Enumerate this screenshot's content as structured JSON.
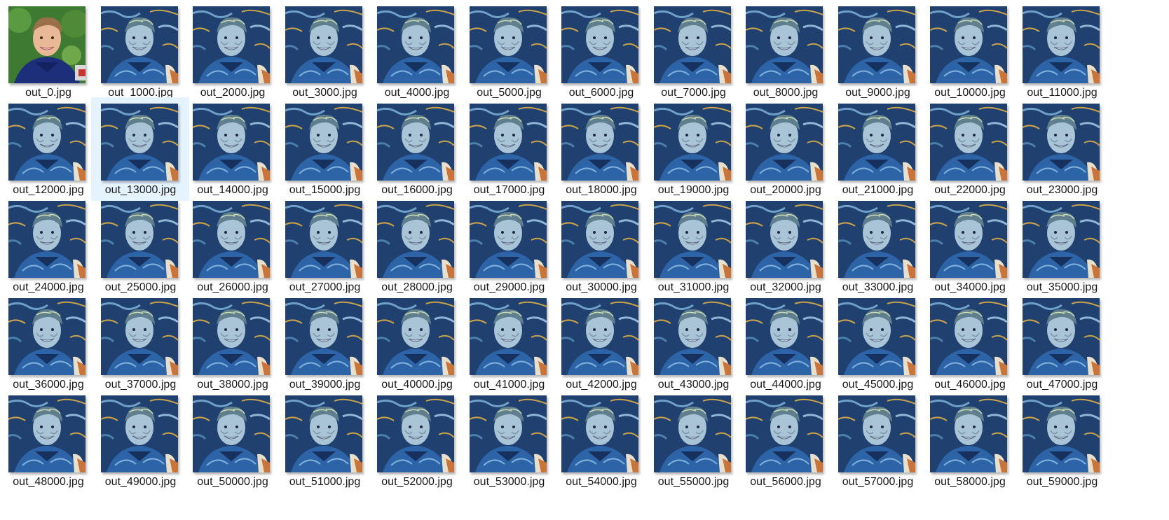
{
  "window": {
    "view": "large-icons"
  },
  "colors": {
    "selection_bg": "#e5f3ff",
    "original_bg": "#3f7a33",
    "original_shirt": "#1d2f7a",
    "styled_bg": "#20416f",
    "styled_shirt": "#2d64a8",
    "styled_accent": "#c9a24a"
  },
  "selected_index": 13,
  "files": [
    {
      "name": "out_0.jpg",
      "style": "original"
    },
    {
      "name": "out_1000.jpg",
      "style": "stylized"
    },
    {
      "name": "out_2000.jpg",
      "style": "stylized"
    },
    {
      "name": "out_3000.jpg",
      "style": "stylized"
    },
    {
      "name": "out_4000.jpg",
      "style": "stylized"
    },
    {
      "name": "out_5000.jpg",
      "style": "stylized"
    },
    {
      "name": "out_6000.jpg",
      "style": "stylized"
    },
    {
      "name": "out_7000.jpg",
      "style": "stylized"
    },
    {
      "name": "out_8000.jpg",
      "style": "stylized"
    },
    {
      "name": "out_9000.jpg",
      "style": "stylized"
    },
    {
      "name": "out_10000.jpg",
      "style": "stylized"
    },
    {
      "name": "out_11000.jpg",
      "style": "stylized"
    },
    {
      "name": "out_12000.jpg",
      "style": "stylized"
    },
    {
      "name": "out_13000.jpg",
      "style": "stylized"
    },
    {
      "name": "out_14000.jpg",
      "style": "stylized"
    },
    {
      "name": "out_15000.jpg",
      "style": "stylized"
    },
    {
      "name": "out_16000.jpg",
      "style": "stylized"
    },
    {
      "name": "out_17000.jpg",
      "style": "stylized"
    },
    {
      "name": "out_18000.jpg",
      "style": "stylized"
    },
    {
      "name": "out_19000.jpg",
      "style": "stylized"
    },
    {
      "name": "out_20000.jpg",
      "style": "stylized"
    },
    {
      "name": "out_21000.jpg",
      "style": "stylized"
    },
    {
      "name": "out_22000.jpg",
      "style": "stylized"
    },
    {
      "name": "out_23000.jpg",
      "style": "stylized"
    },
    {
      "name": "out_24000.jpg",
      "style": "stylized"
    },
    {
      "name": "out_25000.jpg",
      "style": "stylized"
    },
    {
      "name": "out_26000.jpg",
      "style": "stylized"
    },
    {
      "name": "out_27000.jpg",
      "style": "stylized"
    },
    {
      "name": "out_28000.jpg",
      "style": "stylized"
    },
    {
      "name": "out_29000.jpg",
      "style": "stylized"
    },
    {
      "name": "out_30000.jpg",
      "style": "stylized"
    },
    {
      "name": "out_31000.jpg",
      "style": "stylized"
    },
    {
      "name": "out_32000.jpg",
      "style": "stylized"
    },
    {
      "name": "out_33000.jpg",
      "style": "stylized"
    },
    {
      "name": "out_34000.jpg",
      "style": "stylized"
    },
    {
      "name": "out_35000.jpg",
      "style": "stylized"
    },
    {
      "name": "out_36000.jpg",
      "style": "stylized"
    },
    {
      "name": "out_37000.jpg",
      "style": "stylized"
    },
    {
      "name": "out_38000.jpg",
      "style": "stylized"
    },
    {
      "name": "out_39000.jpg",
      "style": "stylized"
    },
    {
      "name": "out_40000.jpg",
      "style": "stylized"
    },
    {
      "name": "out_41000.jpg",
      "style": "stylized"
    },
    {
      "name": "out_42000.jpg",
      "style": "stylized"
    },
    {
      "name": "out_43000.jpg",
      "style": "stylized"
    },
    {
      "name": "out_44000.jpg",
      "style": "stylized"
    },
    {
      "name": "out_45000.jpg",
      "style": "stylized"
    },
    {
      "name": "out_46000.jpg",
      "style": "stylized"
    },
    {
      "name": "out_47000.jpg",
      "style": "stylized"
    },
    {
      "name": "out_48000.jpg",
      "style": "stylized"
    },
    {
      "name": "out_49000.jpg",
      "style": "stylized"
    },
    {
      "name": "out_50000.jpg",
      "style": "stylized"
    },
    {
      "name": "out_51000.jpg",
      "style": "stylized"
    },
    {
      "name": "out_52000.jpg",
      "style": "stylized"
    },
    {
      "name": "out_53000.jpg",
      "style": "stylized"
    },
    {
      "name": "out_54000.jpg",
      "style": "stylized"
    },
    {
      "name": "out_55000.jpg",
      "style": "stylized"
    },
    {
      "name": "out_56000.jpg",
      "style": "stylized"
    },
    {
      "name": "out_57000.jpg",
      "style": "stylized"
    },
    {
      "name": "out_58000.jpg",
      "style": "stylized"
    },
    {
      "name": "out_59000.jpg",
      "style": "stylized"
    }
  ]
}
